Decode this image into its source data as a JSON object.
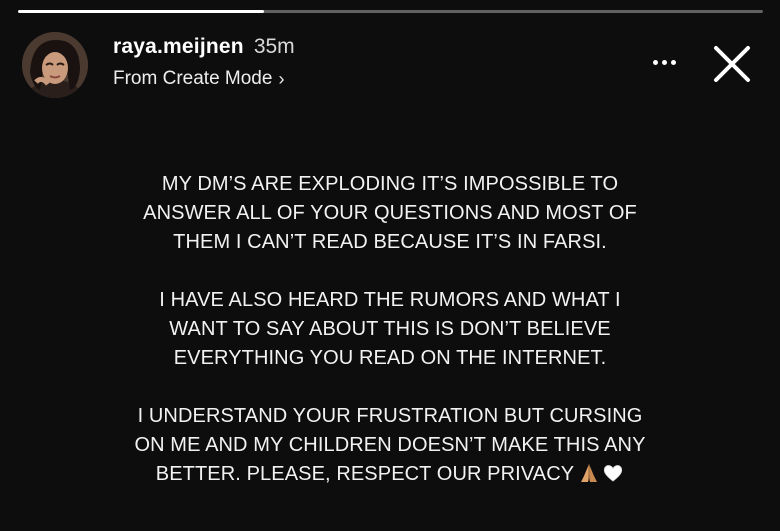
{
  "story": {
    "progress": 0.33
  },
  "header": {
    "username": "raya.meijnen",
    "time": "35m",
    "subtitle": "From Create Mode",
    "subtitle_chevron": "›",
    "more_icon": "more-dots-icon",
    "close_icon": "close-x-icon"
  },
  "message": {
    "paragraphs": [
      [
        "MY DM’S ARE EXPLODING IT’S IMPOSSIBLE TO",
        "ANSWER ALL OF YOUR QUESTIONS AND MOST OF",
        "THEM I CAN’T READ BECAUSE IT’S IN FARSI."
      ],
      [
        "I HAVE ALSO HEARD THE RUMORS AND WHAT I",
        "WANT TO SAY ABOUT THIS IS DON’T BELIEVE",
        "EVERYTHING YOU READ ON THE INTERNET."
      ],
      [
        "I UNDERSTAND YOUR FRUSTRATION BUT CURSING",
        "ON ME AND MY CHILDREN DOESN’T MAKE THIS ANY",
        "BETTER. PLEASE, RESPECT OUR PRIVACY"
      ]
    ],
    "trailing_emojis": [
      "folded-hands-icon",
      "white-heart-icon"
    ]
  },
  "colors": {
    "background": "#0d0d0d",
    "text": "#f2f2f2",
    "progress_fill": "#ffffff",
    "progress_track": "rgba(255,255,255,0.35)"
  }
}
